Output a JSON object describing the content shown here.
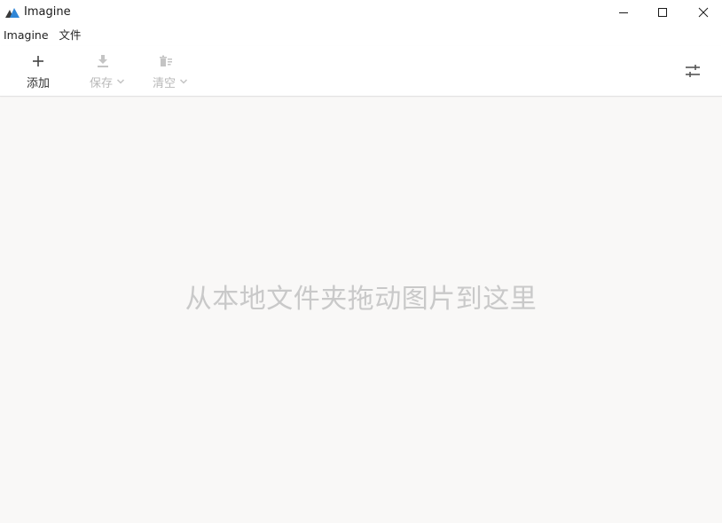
{
  "window": {
    "title": "Imagine",
    "accent": "#2f86d6"
  },
  "menu": {
    "items": [
      {
        "label": "Imagine"
      },
      {
        "label": "文件"
      }
    ]
  },
  "toolbar": {
    "add": {
      "label": "添加",
      "icon": "plus-icon",
      "enabled": true
    },
    "save": {
      "label": "保存",
      "icon": "download-icon",
      "enabled": false
    },
    "clear": {
      "label": "清空",
      "icon": "clear-list-icon",
      "enabled": false
    },
    "settings": {
      "icon": "sliders-icon"
    }
  },
  "dropzone": {
    "hint": "从本地文件夹拖动图片到这里"
  }
}
